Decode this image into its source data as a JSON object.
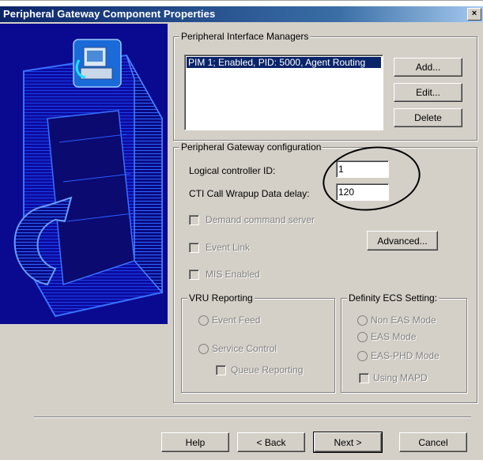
{
  "window": {
    "title": "Peripheral Gateway Component Properties",
    "close_glyph": "×"
  },
  "pim_group": {
    "legend": "Peripheral Interface Managers",
    "items": [
      "PIM 1; Enabled, PID: 5000, Agent Routing"
    ],
    "add_label": "Add...",
    "edit_label": "Edit...",
    "delete_label": "Delete"
  },
  "pg_config": {
    "legend": "Peripheral Gateway configuration",
    "logical_controller_label": "Logical controller ID:",
    "logical_controller_value": "1",
    "cti_delay_label": "CTI Call Wrapup Data delay:",
    "cti_delay_value": "120",
    "demand_command_label": "Demand command server",
    "event_link_label": "Event Link",
    "mis_enabled_label": "MIS Enabled",
    "advanced_label": "Advanced..."
  },
  "vru": {
    "legend": "VRU Reporting",
    "event_feed_label": "Event Feed",
    "service_control_label": "Service Control",
    "queue_reporting_label": "Queue Reporting"
  },
  "definity": {
    "legend": "Definity ECS Setting:",
    "non_eas_label": "Non EAS Mode",
    "eas_label": "EAS Mode",
    "eas_phd_label": "EAS-PHD Mode",
    "using_mapd_label": "Using MAPD"
  },
  "footer": {
    "help_label": "Help",
    "back_label": "< Back",
    "next_label": "Next >",
    "cancel_label": "Cancel"
  }
}
